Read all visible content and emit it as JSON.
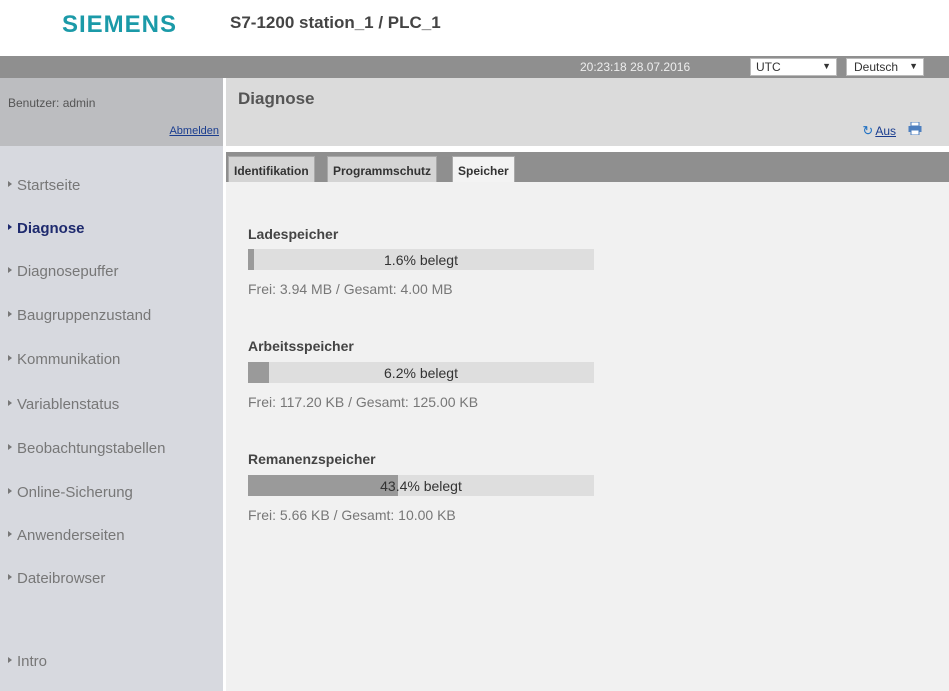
{
  "header": {
    "logo": "SIEMENS",
    "station_title": "S7-1200 station_1 / PLC_1"
  },
  "statusbar": {
    "time": "20:23:18",
    "date": "28.07.2016",
    "timezone": "UTC",
    "language": "Deutsch"
  },
  "sidebar": {
    "user_label": "Benutzer: admin",
    "logout": "Abmelden",
    "items": [
      {
        "label": "Startseite",
        "active": false
      },
      {
        "label": "Diagnose",
        "active": true
      },
      {
        "label": "Diagnosepuffer",
        "active": false
      },
      {
        "label": "Baugruppenzustand",
        "active": false
      },
      {
        "label": "Kommunikation",
        "active": false
      },
      {
        "label": "Variablenstatus",
        "active": false
      },
      {
        "label": "Beobachtungstabellen",
        "active": false
      },
      {
        "label": "Online-Sicherung",
        "active": false
      },
      {
        "label": "Anwenderseiten",
        "active": false
      },
      {
        "label": "Dateibrowser",
        "active": false
      }
    ],
    "intro": "Intro"
  },
  "main": {
    "title": "Diagnose",
    "refresh_label": "Aus",
    "tabs": [
      {
        "label": "Identifikation",
        "active": false
      },
      {
        "label": "Programmschutz",
        "active": false
      },
      {
        "label": "Speicher",
        "active": true
      }
    ],
    "memory": [
      {
        "title": "Ladespeicher",
        "used_percent": 1.6,
        "used_label": "1.6% belegt",
        "free_text": "Frei: 3.94 MB / Gesamt: 4.00 MB"
      },
      {
        "title": "Arbeitsspeicher",
        "used_percent": 6.2,
        "used_label": "6.2% belegt",
        "free_text": "Frei: 117.20 KB / Gesamt: 125.00 KB"
      },
      {
        "title": "Remanenzspeicher",
        "used_percent": 43.4,
        "used_label": "43.4% belegt",
        "free_text": "Frei: 5.66 KB / Gesamt: 10.00 KB"
      }
    ]
  },
  "colors": {
    "brand": "#1b9aa8",
    "nav_active": "#1e2a6e",
    "link": "#1a3d8f",
    "bar_fill": "#9a9a9a"
  },
  "icons": {
    "refresh": "refresh-icon",
    "print": "print-icon"
  }
}
